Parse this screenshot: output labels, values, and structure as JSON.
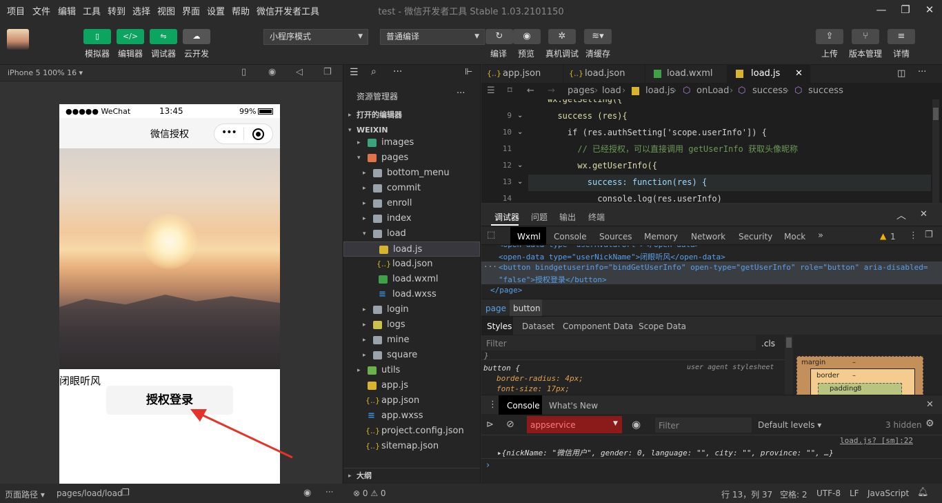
{
  "menu": {
    "items": [
      "项目",
      "文件",
      "编辑",
      "工具",
      "转到",
      "选择",
      "视图",
      "界面",
      "设置",
      "帮助",
      "微信开发者工具"
    ]
  },
  "window": {
    "title": "test - 微信开发者工具 Stable 1.03.2101150"
  },
  "toolbar": {
    "left_buttons": [
      "模拟器",
      "编辑器",
      "调试器",
      "云开发"
    ],
    "mode_select": "小程序模式",
    "compile_select": "普通编译",
    "actions": [
      "编译",
      "预览",
      "真机调试",
      "清缓存"
    ],
    "right_actions": [
      "上传",
      "版本管理",
      "详情"
    ]
  },
  "simulator": {
    "device": "iPhone 5 100% 16 ▾",
    "status": {
      "carrier": "●●●●● WeChat",
      "time": "13:45",
      "battery": "99%"
    },
    "nav_title": "微信授权",
    "nickname": "闭眼听风",
    "auth_button": "授权登录"
  },
  "explorer": {
    "title": "资源管理器",
    "open_editors": "打开的编辑器",
    "project": "WEIXIN",
    "items": [
      "images",
      "pages",
      "bottom_menu",
      "commit",
      "enroll",
      "index",
      "load",
      "load.js",
      "load.json",
      "load.wxml",
      "load.wxss",
      "login",
      "logs",
      "mine",
      "square",
      "utils",
      "app.js",
      "app.json",
      "app.wxss",
      "project.config.json",
      "sitemap.json"
    ],
    "outline": "大纲"
  },
  "editor": {
    "tabs": [
      "app.json",
      "load.json",
      "load.wxml",
      "load.js"
    ],
    "breadcrumb": [
      "pages",
      "load",
      "load.js",
      "onLoad",
      "success",
      "success"
    ],
    "lines": [
      {
        "n": "",
        "code": "wx.getSetting({"
      },
      {
        "n": "9",
        "code": "  success (res){"
      },
      {
        "n": "10",
        "code": "    if (res.authSetting['scope.userInfo']) {"
      },
      {
        "n": "11",
        "code": "      // 已经授权，可以直接调用 getUserInfo 获取头像昵称"
      },
      {
        "n": "12",
        "code": "      wx.getUserInfo({"
      },
      {
        "n": "13",
        "code": "        success: function(res) {"
      },
      {
        "n": "14",
        "code": "          console.log(res.userInfo)"
      }
    ]
  },
  "devtools": {
    "top_tabs": [
      "调试器",
      "问题",
      "输出",
      "终端"
    ],
    "panel_tabs": [
      "Wxml",
      "Console",
      "Sources",
      "Memory",
      "Network",
      "Security",
      "Mock"
    ],
    "warning_count": "1",
    "wxml_lines": [
      "<open-data type=\"userNickName\">闭眼听风</open-data>",
      "<button bindgetuserinfo=\"bindGetUserInfo\" open-type=\"getUserInfo\" role=\"button\" aria-disabled=",
      "\"false\">授权登录</button>",
      "</page>"
    ],
    "element_crumbs": [
      "page",
      "button"
    ],
    "style_tabs": [
      "Styles",
      "Dataset",
      "Component Data",
      "Scope Data"
    ],
    "filter_placeholder": "Filter",
    "cls": ".cls",
    "style_rule": {
      "selector": "button {",
      "source": "user agent stylesheet",
      "props": [
        "border-radius: 4px;",
        "font-size: 17px;"
      ]
    },
    "box_model": {
      "margin": "margin",
      "border": "border",
      "padding": "padding",
      "dash": "–",
      "padding_val": "8"
    },
    "console_tabs": [
      "Console",
      "What's New"
    ],
    "context": "appservice",
    "console_filter": "Filter",
    "levels": "Default levels ▾",
    "hidden": "3 hidden",
    "log_source": "load.js? [sm]:22",
    "log_line": "▸{nickName: \"微信用户\", gender: 0, language: \"\", city: \"\", province: \"\", …}",
    "prompt": "›"
  },
  "statusbar": {
    "path_label": "页面路径 ▾",
    "path": "pages/load/load",
    "errors": "⊗ 0 ⚠ 0",
    "position": "行 13，列 37",
    "spaces": "空格: 2",
    "encoding": "UTF-8",
    "eol": "LF",
    "lang": "JavaScript"
  }
}
